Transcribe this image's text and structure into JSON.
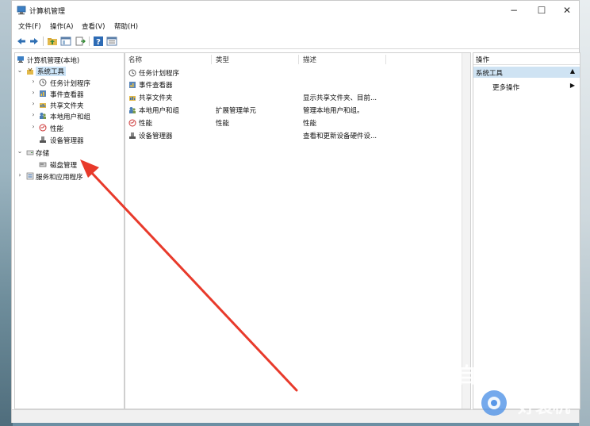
{
  "window": {
    "title": "计算机管理",
    "minimize_glyph": "−",
    "maximize_glyph": "☐",
    "close_glyph": "✕"
  },
  "menu": [
    "文件(F)",
    "操作(A)",
    "查看(V)",
    "帮助(H)"
  ],
  "toolbar_icons": [
    "back-icon",
    "forward-icon",
    "up-folder-icon",
    "show-hide-tree-icon",
    "export-list-icon",
    "help-icon",
    "properties-icon"
  ],
  "tree": {
    "root": "计算机管理(本地)",
    "system_tools": "系统工具",
    "children": [
      "任务计划程序",
      "事件查看器",
      "共享文件夹",
      "本地用户和组",
      "性能",
      "设备管理器"
    ],
    "storage": "存储",
    "disk_management": "磁盘管理",
    "services": "服务和应用程序"
  },
  "list": {
    "columns": [
      "名称",
      "类型",
      "描述"
    ],
    "rows": [
      {
        "name": "任务计划程序",
        "type": "",
        "desc": "",
        "icon": "clock-icon"
      },
      {
        "name": "事件查看器",
        "type": "",
        "desc": "",
        "icon": "event-viewer-icon"
      },
      {
        "name": "共享文件夹",
        "type": "",
        "desc": "显示共享文件夹、目前...",
        "icon": "shared-folder-icon"
      },
      {
        "name": "本地用户和组",
        "type": "扩展管理单元",
        "desc": "管理本地用户和组。",
        "icon": "users-icon"
      },
      {
        "name": "性能",
        "type": "性能",
        "desc": "性能",
        "icon": "performance-icon"
      },
      {
        "name": "设备管理器",
        "type": "",
        "desc": "查看和更新设备硬件设...",
        "icon": "device-manager-icon"
      }
    ]
  },
  "actions": {
    "header": "操作",
    "section": "系统工具",
    "more": "更多操作"
  },
  "watermark": {
    "top": "自由互联",
    "bottom": "好装机"
  },
  "colors": {
    "selection": "#cce4f7",
    "arrow": "#e83a2b"
  }
}
